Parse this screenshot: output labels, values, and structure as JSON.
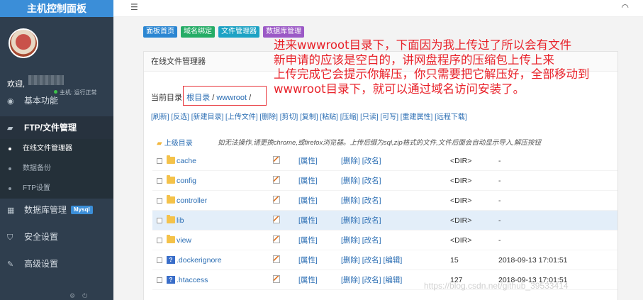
{
  "sidebar": {
    "title": "主机控制面板",
    "greeting": "欢迎,",
    "status": "主机: 运行正常",
    "nav": [
      {
        "label": "基本功能",
        "icon": "dashboard-icon"
      },
      {
        "label": "FTP/文件管理",
        "icon": "folder-icon",
        "active": true
      }
    ],
    "sub": [
      {
        "label": "在线文件管理器",
        "active": true
      },
      {
        "label": "数据备份"
      },
      {
        "label": "FTP设置"
      }
    ],
    "nav2": [
      {
        "label": "数据库管理",
        "badge": "Mysql"
      },
      {
        "label": "安全设置"
      },
      {
        "label": "高级设置"
      }
    ]
  },
  "quick_buttons": [
    "面板首页",
    "域名绑定",
    "文件管理器",
    "数据库管理"
  ],
  "panel": {
    "title": "在线文件管理器",
    "current_dir_label": "当前目录:",
    "root_link": "根目录",
    "sep": "/",
    "dir_link": "wwwroot",
    "trail": "/"
  },
  "toolbar": [
    "[刷新]",
    "[反选]",
    "[新建目录]",
    "[上传文件]",
    "[删除]",
    "[剪切]",
    "[复制]",
    "[粘贴]",
    "[压缩]",
    "[只读]",
    "[可写]",
    "[重建属性]",
    "[远程下载]"
  ],
  "parent_dir": "上级目录",
  "hint": "如无法操作,请更换chrome,或firefox浏览器。上传后缀为sql,zip格式的文件,文件后面会自动显示导入,解压按钮",
  "files": [
    {
      "name": "cache",
      "type": "dir",
      "attr": "[属性]",
      "ops": "[删除] [改名]",
      "size": "<DIR>",
      "date": "-"
    },
    {
      "name": "config",
      "type": "dir",
      "attr": "[属性]",
      "ops": "[删除] [改名]",
      "size": "<DIR>",
      "date": "-"
    },
    {
      "name": "controller",
      "type": "dir",
      "attr": "[属性]",
      "ops": "[删除] [改名]",
      "size": "<DIR>",
      "date": "-"
    },
    {
      "name": "lib",
      "type": "dir",
      "attr": "[属性]",
      "ops": "[删除] [改名]",
      "size": "<DIR>",
      "date": "-"
    },
    {
      "name": "view",
      "type": "dir",
      "attr": "[属性]",
      "ops": "[删除] [改名]",
      "size": "<DIR>",
      "date": "-"
    },
    {
      "name": ".dockerignore",
      "type": "file",
      "attr": "[属性]",
      "ops": "[删除] [改名] [编辑]",
      "size": "15",
      "date": "2018-09-13 17:01:51"
    },
    {
      "name": ".htaccess",
      "type": "file",
      "attr": "[属性]",
      "ops": "[删除] [改名] [编辑]",
      "size": "127",
      "date": "2018-09-13 17:01:51"
    }
  ],
  "annotation": [
    "进来wwwroot目录下，下面因为我上传过了所以会有文件",
    "新申请的应该是空白的，讲网盘程序的压缩包上传上来",
    "上传完成它会提示你解压，你只需要把它解压好，全部移动到",
    "wwwroot目录下，就可以通过域名访问安装了。"
  ],
  "watermark": "https://blog.csdn.net/github_39533414",
  "colors": {
    "accent": "#3b8ed8",
    "sidebar": "#2f3e4e",
    "annotation": "#e8222a"
  }
}
